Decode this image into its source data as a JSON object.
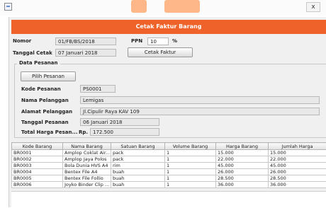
{
  "window": {
    "close_glyph": "x"
  },
  "header": {
    "title": "Cetak Faktur Barang"
  },
  "form": {
    "nomor_label": "Nomor",
    "nomor_value": "01/FB/BS/2018",
    "ppn_label": "PPN",
    "ppn_value": "10",
    "ppn_unit": "%",
    "tanggal_cetak_label": "Tanggal Cetak",
    "tanggal_cetak_value": "07 Januari 2018",
    "cetak_button": "Cetak Faktur"
  },
  "data_pesanan": {
    "title": "Data Pesanan",
    "pilih_button": "Pilih Pesanan",
    "kode_label": "Kode Pesanan",
    "kode_value": "PS0001",
    "nama_label": "Nama Pelanggan",
    "nama_value": "Lemigas",
    "alamat_label": "Alamat Pelanggan",
    "alamat_value": "Jl.Cipulir Raya KAV 109",
    "tanggal_label": "Tanggal Pesanan",
    "tanggal_value": "06 Januari 2018",
    "total_label": "Total Harga Pesan...",
    "currency": "Rp.",
    "total_value": "172.500"
  },
  "table": {
    "columns": [
      "Kode Barang",
      "Nama Barang",
      "Satuan Barang",
      "Volume Barang",
      "Harga Barang",
      "Jumlah Harga"
    ],
    "rows": [
      [
        "BR0001",
        "Amplop Coklat Air...",
        "pack",
        "1",
        "15.000",
        "15.000"
      ],
      [
        "BR0002",
        "Amplop Jaya Polos",
        "pack",
        "1",
        "22.000",
        "22.000"
      ],
      [
        "BR0003",
        "Bola Dunia HVS A4",
        "rim",
        "1",
        "45.000",
        "45.000"
      ],
      [
        "BR0004",
        "Bentex File A4",
        "buah",
        "1",
        "26.000",
        "26.000"
      ],
      [
        "BR0005",
        "Bentex File Follio",
        "buah",
        "1",
        "28.500",
        "28.500"
      ],
      [
        "BR0006",
        "Joyko Binder Clip ...",
        "buah",
        "1",
        "36.000",
        "36.000"
      ]
    ]
  },
  "colors": {
    "header_bg": "#ef632a",
    "window_bg": "#f0f0f0"
  }
}
